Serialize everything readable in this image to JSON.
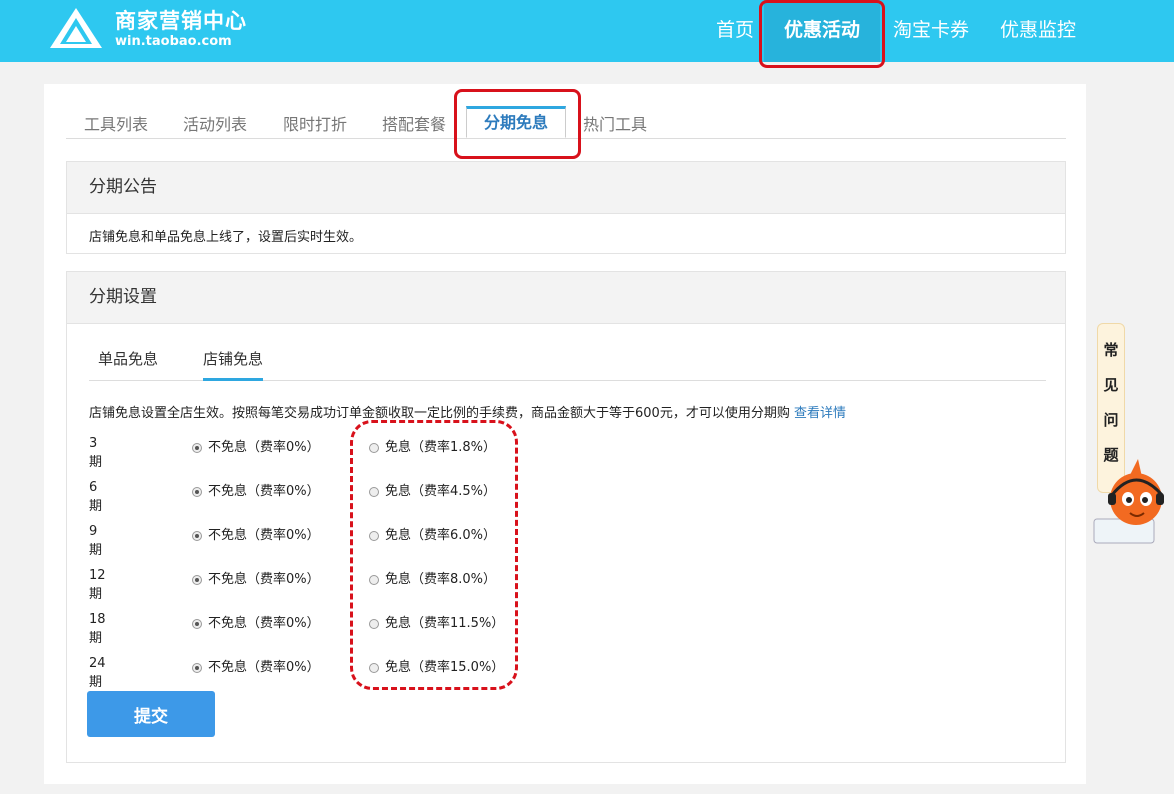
{
  "header": {
    "brand_title": "商家营销中心",
    "brand_url": "win.taobao.com",
    "nav": [
      {
        "label": "首页"
      },
      {
        "label": "优惠活动",
        "active": true
      },
      {
        "label": "淘宝卡券"
      },
      {
        "label": "优惠监控"
      }
    ]
  },
  "tabs": [
    "工具列表",
    "活动列表",
    "限时打折",
    "搭配套餐",
    "分期免息",
    "热门工具"
  ],
  "active_tab": "分期免息",
  "notice": {
    "title": "分期公告",
    "text": "店铺免息和单品免息上线了，设置后实时生效。"
  },
  "settings": {
    "title": "分期设置",
    "subtabs": [
      "单品免息",
      "店铺免息"
    ],
    "active_subtab": "店铺免息",
    "description": "店铺免息设置全店生效。按照每笔交易成功订单金额收取一定比例的手续费，商品金额大于等于600元，才可以使用分期购",
    "detail_link": "查看详情",
    "rows": [
      {
        "period": "3期",
        "off": "不免息（费率0%）",
        "on": "免息（费率1.8%）",
        "selected": "off"
      },
      {
        "period": "6期",
        "off": "不免息（费率0%）",
        "on": "免息（费率4.5%）",
        "selected": "off"
      },
      {
        "period": "9期",
        "off": "不免息（费率0%）",
        "on": "免息（费率6.0%）",
        "selected": "off"
      },
      {
        "period": "12期",
        "off": "不免息（费率0%）",
        "on": "免息（费率8.0%）",
        "selected": "off"
      },
      {
        "period": "18期",
        "off": "不免息（费率0%）",
        "on": "免息（费率11.5%）",
        "selected": "off"
      },
      {
        "period": "24期",
        "off": "不免息（费率0%）",
        "on": "免息（费率15.0%）",
        "selected": "off"
      }
    ],
    "submit_label": "提交"
  },
  "faq": [
    "常",
    "见",
    "问",
    "题"
  ],
  "colors": {
    "topbar": "#2ec8f0",
    "highlight": "#d8111b",
    "link": "#2d7bbd",
    "button": "#3d99e8"
  }
}
